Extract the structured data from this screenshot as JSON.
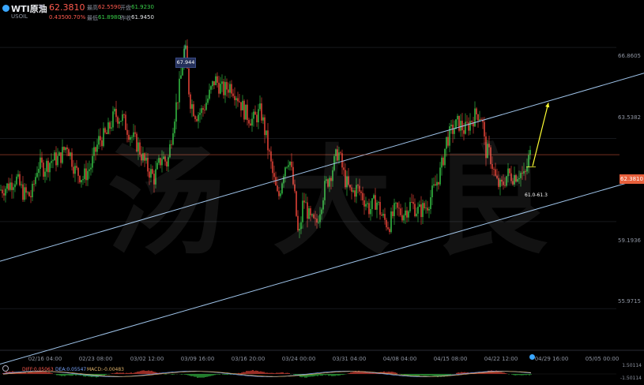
{
  "header": {
    "symbol": "WTI原油",
    "code": "USOIL",
    "last": "62.3810",
    "change": "0.4350",
    "change_pct": "0.70%",
    "high_label": "最高",
    "high": "62.5590",
    "low_label": "最低",
    "low": "61.8980",
    "open_label": "开盘",
    "open": "61.9230",
    "prev_label": "昨收",
    "prev": "61.9450"
  },
  "watermark": [
    "汤",
    "大",
    "良"
  ],
  "peak_label": "67.944",
  "range_label": "61.0-61.3",
  "price_tag": "62.3810",
  "macd": {
    "dif_label": "DIFF:0.05063",
    "dea_label": "DEA:0.05547",
    "macd_label": "MACD:-0.00483",
    "scale_top": "1.50114",
    "scale_bottom": "-1.50114"
  },
  "colors": {
    "up": "#39d04a",
    "down": "#ff4b3e",
    "channel": "#9fc4ea",
    "arrow": "#ffff33",
    "price_line": "#e8603c"
  },
  "chart_data": {
    "type": "candlestick",
    "y_axis_labels": [
      "66.8605",
      "63.5382",
      "62.3810",
      "59.1936",
      "55.9715"
    ],
    "ylim": [
      52.5,
      69.0
    ],
    "x_tick_labels": [
      "02/16 04:00",
      "02/23 08:00",
      "03/02 12:00",
      "03/09 16:00",
      "03/16 20:00",
      "03/24 00:00",
      "03/31 04:00",
      "04/08 04:00",
      "04/15 08:00",
      "04/22 12:00",
      "04/29 16:00",
      "05/05 00:00"
    ],
    "price_path": [
      [
        0,
        60.6
      ],
      [
        10,
        60.8
      ],
      [
        20,
        61.2
      ],
      [
        30,
        60.4
      ],
      [
        40,
        60.3
      ],
      [
        48,
        61.9
      ],
      [
        55,
        61.7
      ],
      [
        65,
        62.1
      ],
      [
        75,
        62.2
      ],
      [
        85,
        62.9
      ],
      [
        95,
        61.6
      ],
      [
        105,
        61.2
      ],
      [
        115,
        61.8
      ],
      [
        125,
        63.1
      ],
      [
        135,
        63.4
      ],
      [
        145,
        64.4
      ],
      [
        155,
        64.2
      ],
      [
        165,
        63.4
      ],
      [
        175,
        62.8
      ],
      [
        185,
        61.8
      ],
      [
        195,
        61.2
      ],
      [
        205,
        62.3
      ],
      [
        212,
        61.9
      ],
      [
        220,
        64.2
      ],
      [
        228,
        66.0
      ],
      [
        234,
        67.944
      ],
      [
        240,
        65.2
      ],
      [
        248,
        64.4
      ],
      [
        256,
        64.6
      ],
      [
        264,
        65.3
      ],
      [
        272,
        66.2
      ],
      [
        282,
        65.6
      ],
      [
        292,
        65.9
      ],
      [
        300,
        65.4
      ],
      [
        310,
        64.5
      ],
      [
        320,
        64.1
      ],
      [
        330,
        64.6
      ],
      [
        338,
        63.0
      ],
      [
        345,
        61.4
      ],
      [
        352,
        60.1
      ],
      [
        360,
        61.8
      ],
      [
        366,
        62.3
      ],
      [
        372,
        60.6
      ],
      [
        378,
        58.0
      ],
      [
        384,
        60.2
      ],
      [
        392,
        59.1
      ],
      [
        400,
        58.8
      ],
      [
        410,
        60.6
      ],
      [
        420,
        61.6
      ],
      [
        428,
        62.6
      ],
      [
        436,
        61.2
      ],
      [
        444,
        60.4
      ],
      [
        452,
        60.7
      ],
      [
        460,
        60.2
      ],
      [
        468,
        59.6
      ],
      [
        476,
        60.1
      ],
      [
        484,
        59.2
      ],
      [
        492,
        58.8
      ],
      [
        500,
        59.6
      ],
      [
        510,
        59.4
      ],
      [
        520,
        59.9
      ],
      [
        530,
        59.5
      ],
      [
        540,
        59.8
      ],
      [
        550,
        60.7
      ],
      [
        558,
        61.6
      ],
      [
        565,
        63.1
      ],
      [
        572,
        63.6
      ],
      [
        580,
        64.0
      ],
      [
        588,
        63.6
      ],
      [
        596,
        64.1
      ],
      [
        604,
        64.5
      ],
      [
        610,
        64.3
      ],
      [
        614,
        62.6
      ],
      [
        620,
        62.4
      ],
      [
        628,
        61.0
      ],
      [
        634,
        60.7
      ],
      [
        642,
        61.4
      ],
      [
        650,
        61.3
      ],
      [
        658,
        61.5
      ],
      [
        664,
        61.2
      ],
      [
        670,
        62.381
      ]
    ],
    "annotations": {
      "peak": {
        "x": 234,
        "value": 67.944
      },
      "current_price": 62.381,
      "channel_upper": [
        [
          0,
          57.0
        ],
        [
          815,
          66.5
        ]
      ],
      "channel_lower": [
        [
          0,
          51.8
        ],
        [
          815,
          61.2
        ]
      ],
      "forecast_arrow": [
        [
          674,
          61.8
        ],
        [
          694,
          65.0
        ]
      ]
    }
  }
}
